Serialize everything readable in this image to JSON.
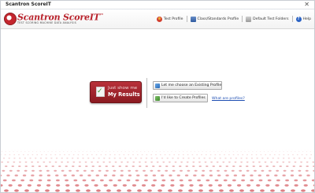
{
  "window": {
    "title": "Scantron ScoreIT",
    "close_glyph": "✕"
  },
  "brand": {
    "name": "Scantron ScoreIT",
    "trademark": "™",
    "tagline": "TEST SCORING MACHINE DATA ANALYSIS"
  },
  "toolbar": {
    "items": [
      {
        "label": "Test Profile",
        "icon": "profile-icon"
      },
      {
        "label": "Class/Standards Profile",
        "icon": "class-standards-icon"
      },
      {
        "label": "Default Test Folders",
        "icon": "folder-icon"
      },
      {
        "label": "Help",
        "icon": "help-icon",
        "glyph": "?"
      }
    ]
  },
  "main": {
    "results_button": {
      "line1": "Just show me",
      "line2": "My Results",
      "icon": "document-check-icon",
      "check_glyph": "✓"
    },
    "options": {
      "existing_label": "Let me choose an Existing Profile",
      "create_label": "I'd like to Create Profiles",
      "help_link": "What are profiles?"
    }
  },
  "colors": {
    "brand_red": "#b8212a",
    "button_red": "#8b1a21",
    "link_blue": "#1f4fb3",
    "floor_dot": "#d7646a"
  }
}
